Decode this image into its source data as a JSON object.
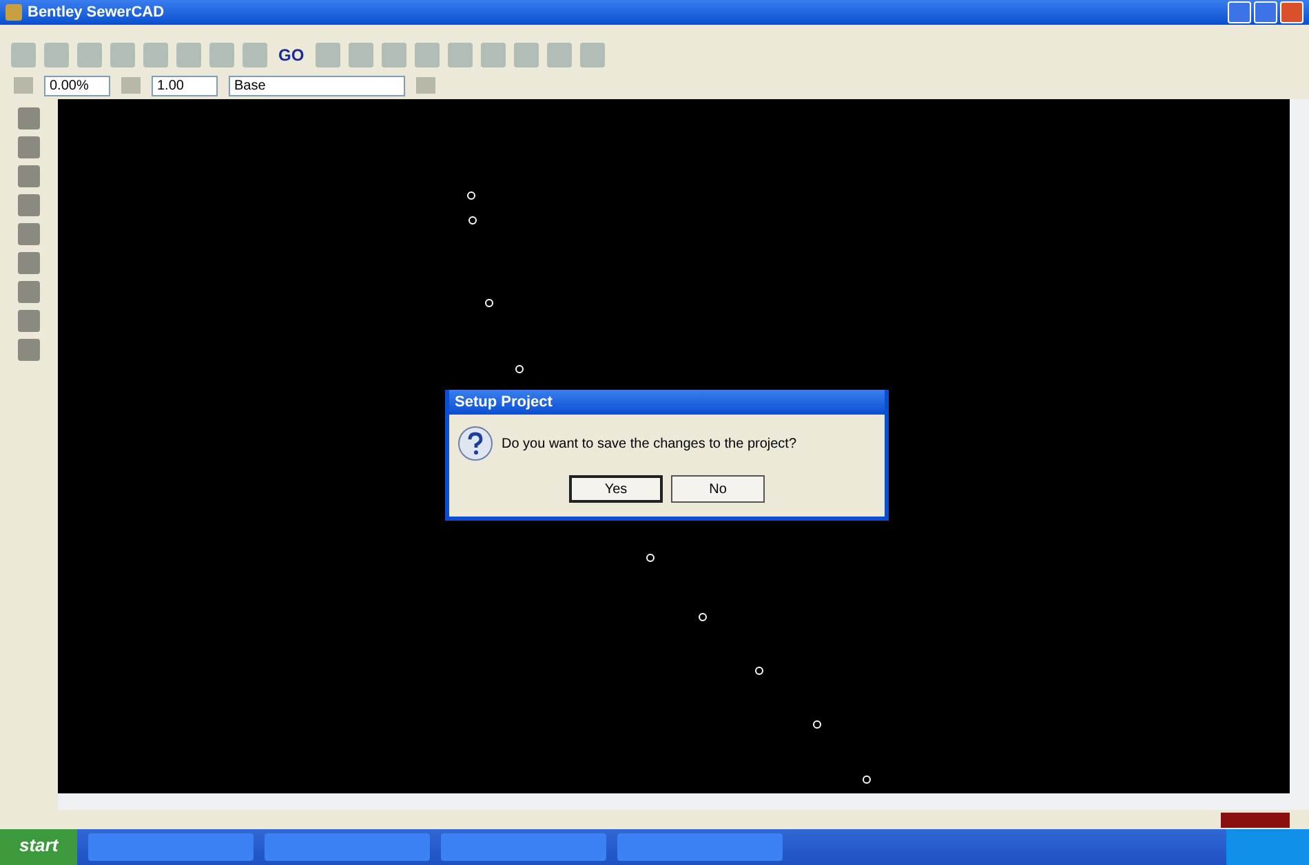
{
  "window": {
    "title": "Bentley SewerCAD"
  },
  "toolbar": {
    "go_label": "GO"
  },
  "toolbar2": {
    "percent": "0.00%",
    "factor": "1.00",
    "scenario": "Base"
  },
  "dialog": {
    "title": "Setup Project",
    "message": "Do you want to save the changes to the project?",
    "buttons": [
      {
        "label": "Yes",
        "selected": true
      },
      {
        "label": "No",
        "selected": false
      }
    ]
  },
  "taskbar": {
    "start": "start"
  }
}
